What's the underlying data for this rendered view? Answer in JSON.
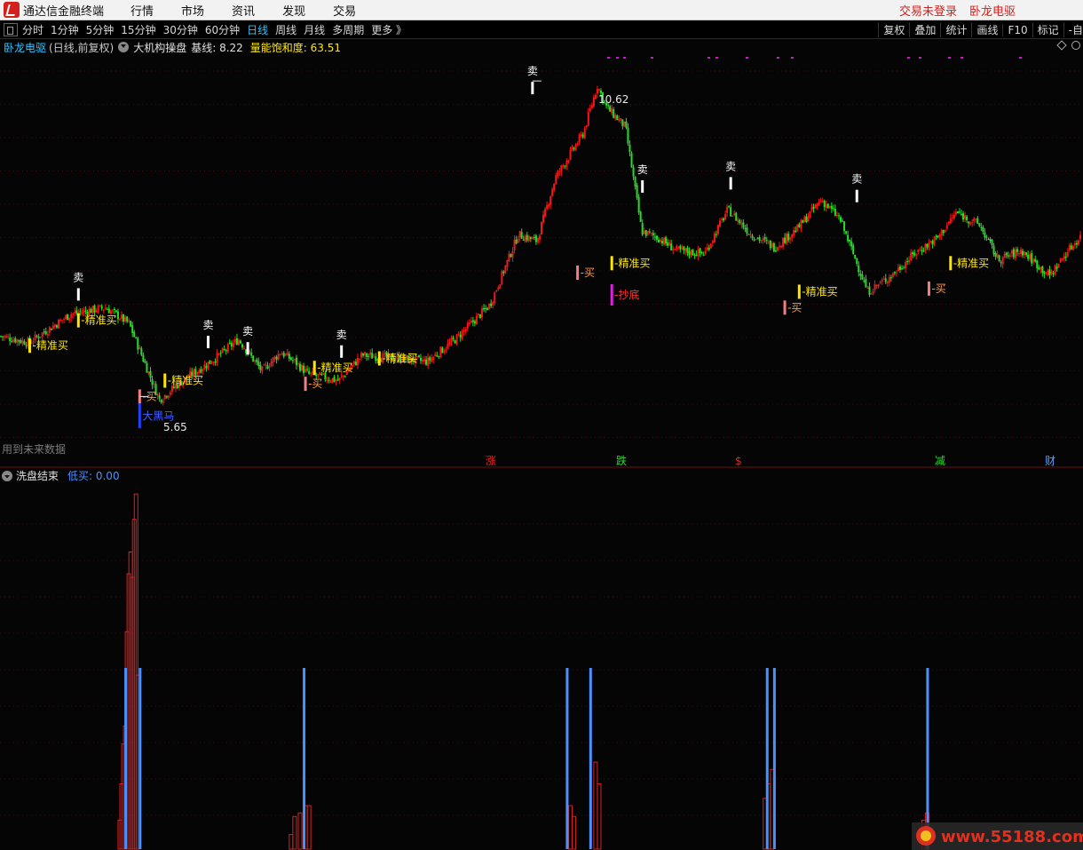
{
  "window": {
    "app_title": "通达信金融终端",
    "menus": [
      "行情",
      "市场",
      "资讯",
      "发现",
      "交易"
    ],
    "right_menus": [
      "交易未登录",
      "卧龙电驱"
    ]
  },
  "toolbar": {
    "periods": [
      "分时",
      "1分钟",
      "5分钟",
      "15分钟",
      "30分钟",
      "60分钟",
      "日线",
      "周线",
      "月线",
      "多周期",
      "更多 》"
    ],
    "active_period": "日线",
    "tools": [
      "复权",
      "叠加",
      "统计",
      "画线",
      "F10",
      "标记",
      "-自"
    ]
  },
  "main_panel": {
    "stock_name": "卧龙电驱",
    "chart_mode": "(日线,前复权)",
    "indicator_name": "大机构操盘",
    "baseline_label": "基线: 8.22",
    "saturation_label": "量能饱和度: 63.51",
    "future_data_note": "用到未来数据",
    "high_price_label": "10.62",
    "low_price_label": "5.65",
    "signal_texts": {
      "sell": "卖",
      "buy": "买",
      "precise_buy": "精准买",
      "bottom": "抄底",
      "dark_horse": "大黑马"
    },
    "bottom_markers": [
      "涨",
      "跌",
      "$",
      "减",
      "财"
    ]
  },
  "sub_panel": {
    "indicator_name": "洗盘结束",
    "value_label": "低买: 0.00"
  },
  "watermark": "www.55188.com",
  "colors": {
    "up": "#f21818",
    "down": "#22e022",
    "signal_yellow": "#ffe600",
    "signal_salmon": "#f08080",
    "bottom_magenta": "#e020e0",
    "dark_horse_blue": "#2040ff",
    "sub_bar_blue": "#4a90ff",
    "sub_bar_red": "#d82020",
    "title_blue": "#31c4ff"
  },
  "chart_data": [
    {
      "type": "candlestick",
      "title": "卧龙电驱 (日线,前复权)",
      "xlabel": "",
      "ylabel": "",
      "ylim": [
        4.9,
        11.0
      ],
      "grid": true,
      "notes": "Daily candles reconstructed approximately from the screenshot, 300 sessions; close price path keyed by session index.",
      "close_path": [
        [
          0,
          6.6
        ],
        [
          12,
          6.5
        ],
        [
          30,
          6.95
        ],
        [
          45,
          7.05
        ],
        [
          55,
          6.8
        ],
        [
          68,
          5.6
        ],
        [
          78,
          5.9
        ],
        [
          92,
          6.25
        ],
        [
          102,
          6.55
        ],
        [
          112,
          6.05
        ],
        [
          120,
          6.35
        ],
        [
          126,
          6.2
        ],
        [
          132,
          6.0
        ],
        [
          145,
          5.9
        ],
        [
          155,
          6.3
        ],
        [
          170,
          6.25
        ],
        [
          183,
          6.2
        ],
        [
          195,
          6.55
        ],
        [
          210,
          7.1
        ],
        [
          222,
          8.2
        ],
        [
          230,
          8.1
        ],
        [
          238,
          9.1
        ],
        [
          250,
          9.8
        ],
        [
          256,
          10.55
        ],
        [
          260,
          10.2
        ],
        [
          268,
          9.9
        ],
        [
          275,
          8.25
        ],
        [
          282,
          8.15
        ],
        [
          290,
          7.95
        ],
        [
          302,
          7.9
        ],
        [
          312,
          8.6
        ],
        [
          322,
          8.2
        ],
        [
          332,
          8.0
        ],
        [
          342,
          8.3
        ],
        [
          352,
          8.75
        ],
        [
          360,
          8.45
        ],
        [
          372,
          7.3
        ],
        [
          382,
          7.55
        ],
        [
          392,
          7.9
        ],
        [
          402,
          8.15
        ],
        [
          410,
          8.55
        ],
        [
          420,
          8.35
        ],
        [
          428,
          7.8
        ],
        [
          438,
          7.95
        ],
        [
          450,
          7.55
        ],
        [
          458,
          7.95
        ],
        [
          464,
          8.2
        ]
      ],
      "signals": [
        {
          "session": 16,
          "type": "精准买",
          "price": 6.45
        },
        {
          "session": 43,
          "type": "卖",
          "price": 7.3
        },
        {
          "session": 43,
          "type": "精准买",
          "price": 6.85
        },
        {
          "session": 77,
          "type": "买",
          "price": 5.65
        },
        {
          "session": 77,
          "type": "大黑马",
          "price": 5.4
        },
        {
          "session": 91,
          "type": "精准买",
          "price": 5.9
        },
        {
          "session": 115,
          "type": "卖",
          "price": 6.55
        },
        {
          "session": 137,
          "type": "卖",
          "price": 6.45
        },
        {
          "session": 169,
          "type": "买",
          "price": 5.85
        },
        {
          "session": 174,
          "type": "精准买",
          "price": 6.1
        },
        {
          "session": 189,
          "type": "卖",
          "price": 6.4
        },
        {
          "session": 210,
          "type": "精准买",
          "price": 6.25
        },
        {
          "session": 295,
          "type": "卖",
          "price": 10.55
        },
        {
          "session": 320,
          "type": "买",
          "price": 7.6
        },
        {
          "session": 339,
          "type": "精准买",
          "price": 7.75
        },
        {
          "session": 339,
          "type": "抄底",
          "price": 7.25
        },
        {
          "session": 356,
          "type": "卖",
          "price": 9.0
        },
        {
          "session": 405,
          "type": "卖",
          "price": 9.05
        },
        {
          "session": 435,
          "type": "买",
          "price": 7.05
        },
        {
          "session": 443,
          "type": "精准买",
          "price": 7.3
        },
        {
          "session": 475,
          "type": "卖",
          "price": 8.85
        },
        {
          "session": 515,
          "type": "买",
          "price": 7.35
        },
        {
          "session": 527,
          "type": "精准买",
          "price": 7.75
        }
      ],
      "annotations": [
        {
          "text": "10.62",
          "price": 10.62,
          "session": 295
        },
        {
          "text": "5.65",
          "price": 5.65,
          "session": 77
        }
      ]
    },
    {
      "type": "bar",
      "title": "洗盘结束",
      "ylabel": "",
      "ylim": [
        0,
        100
      ],
      "series": [
        {
          "values_by_session": [
            [
              66,
              8
            ],
            [
              67,
              18
            ],
            [
              68,
              29
            ],
            [
              69,
              34
            ],
            [
              70,
              60
            ],
            [
              71,
              76
            ],
            [
              72,
              82
            ],
            [
              73,
              75
            ],
            [
              74,
              91
            ],
            [
              75,
              98
            ],
            [
              76,
              48
            ],
            [
              161,
              4
            ],
            [
              163,
              9
            ],
            [
              166,
              10
            ],
            [
              169,
              12
            ],
            [
              171,
              12
            ],
            [
              316,
              12
            ],
            [
              318,
              9
            ],
            [
              330,
              24
            ],
            [
              332,
              18
            ],
            [
              424,
              14
            ],
            [
              426,
              18
            ],
            [
              428,
              22
            ],
            [
              512,
              8
            ],
            [
              514,
              10
            ]
          ]
        },
        {
          "values_by_session": [
            [
              69,
              50
            ],
            [
              77,
              50
            ],
            [
              168,
              50
            ],
            [
              314,
              50
            ],
            [
              327,
              50
            ],
            [
              425,
              50
            ],
            [
              429,
              50
            ],
            [
              514,
              50
            ]
          ]
        }
      ]
    }
  ]
}
